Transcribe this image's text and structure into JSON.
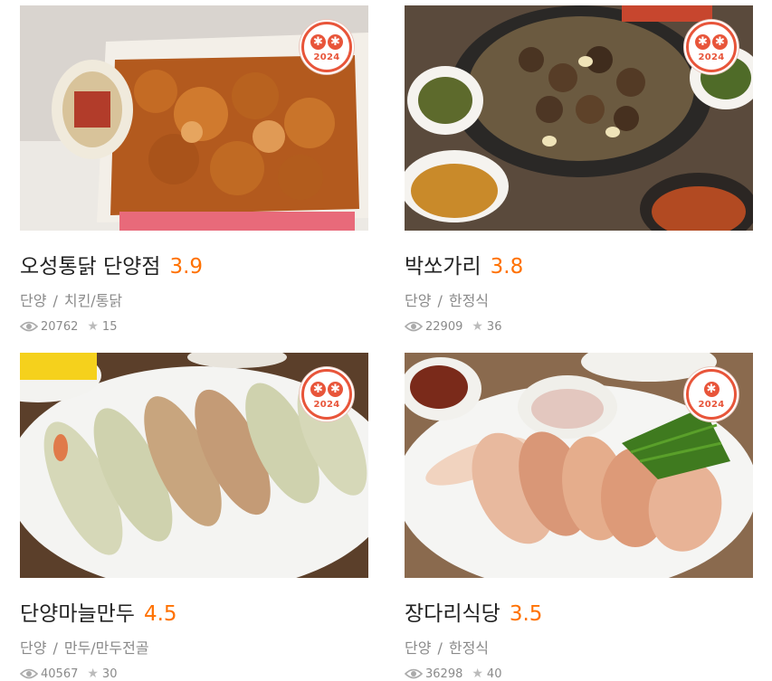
{
  "restaurants": [
    {
      "name": "오성통닭 단양점",
      "score": "3.9",
      "region": "단양",
      "category": "치킨/통닭",
      "views": "20762",
      "reviews": "15",
      "badge_year": "2024",
      "badge_stars": 2,
      "photo_icon": "fried-chicken-photo"
    },
    {
      "name": "박쏘가리",
      "score": "3.8",
      "region": "단양",
      "category": "한정식",
      "views": "22909",
      "reviews": "36",
      "badge_year": "2024",
      "badge_stars": 2,
      "photo_icon": "bulgogi-garlic-photo"
    },
    {
      "name": "단양마늘만두",
      "score": "4.5",
      "region": "단양",
      "category": "만두/만두전골",
      "views": "40567",
      "reviews": "30",
      "badge_year": "2024",
      "badge_stars": 2,
      "photo_icon": "dumplings-photo"
    },
    {
      "name": "장다리식당",
      "score": "3.5",
      "region": "단양",
      "category": "한정식",
      "views": "36298",
      "reviews": "40",
      "badge_year": "2024",
      "badge_stars": 1,
      "photo_icon": "bossam-photo"
    }
  ],
  "separator": "/",
  "colors": {
    "score": "#ff7100",
    "badge": "#e8553a",
    "meta": "#8a8a8a"
  }
}
